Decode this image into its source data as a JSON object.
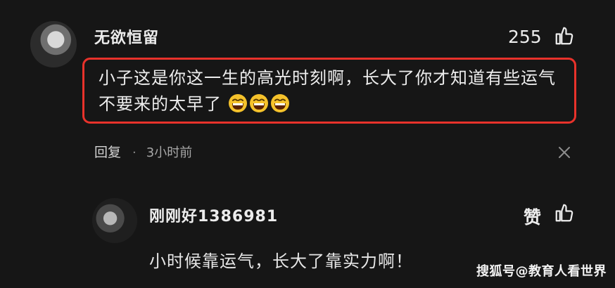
{
  "comment": {
    "username": "无欲恒留",
    "like_count": "255",
    "text": "小子这是你这一生的高光时刻啊，长大了你才知道有些运气不要来的太早了",
    "emojis": [
      "grinning-face-icon",
      "grinning-face-icon",
      "grinning-face-icon"
    ],
    "reply_label": "回复",
    "separator": "·",
    "time": "3小时前"
  },
  "reply": {
    "username": "刚刚好1386981",
    "like_label": "赞",
    "text": "小时候靠运气，长大了靠实力啊！"
  },
  "watermark": "搜狐号@教育人看世界",
  "colors": {
    "background": "#161616",
    "highlight": "#e8322b",
    "emoji": "#f5c22b"
  }
}
